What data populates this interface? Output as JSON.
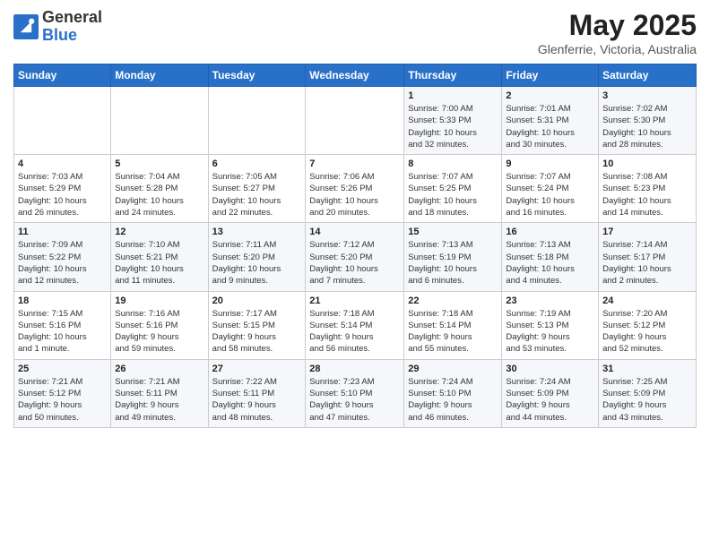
{
  "header": {
    "logo_general": "General",
    "logo_blue": "Blue",
    "month_year": "May 2025",
    "location": "Glenferrie, Victoria, Australia"
  },
  "weekdays": [
    "Sunday",
    "Monday",
    "Tuesday",
    "Wednesday",
    "Thursday",
    "Friday",
    "Saturday"
  ],
  "weeks": [
    [
      {
        "day": "",
        "info": ""
      },
      {
        "day": "",
        "info": ""
      },
      {
        "day": "",
        "info": ""
      },
      {
        "day": "",
        "info": ""
      },
      {
        "day": "1",
        "info": "Sunrise: 7:00 AM\nSunset: 5:33 PM\nDaylight: 10 hours\nand 32 minutes."
      },
      {
        "day": "2",
        "info": "Sunrise: 7:01 AM\nSunset: 5:31 PM\nDaylight: 10 hours\nand 30 minutes."
      },
      {
        "day": "3",
        "info": "Sunrise: 7:02 AM\nSunset: 5:30 PM\nDaylight: 10 hours\nand 28 minutes."
      }
    ],
    [
      {
        "day": "4",
        "info": "Sunrise: 7:03 AM\nSunset: 5:29 PM\nDaylight: 10 hours\nand 26 minutes."
      },
      {
        "day": "5",
        "info": "Sunrise: 7:04 AM\nSunset: 5:28 PM\nDaylight: 10 hours\nand 24 minutes."
      },
      {
        "day": "6",
        "info": "Sunrise: 7:05 AM\nSunset: 5:27 PM\nDaylight: 10 hours\nand 22 minutes."
      },
      {
        "day": "7",
        "info": "Sunrise: 7:06 AM\nSunset: 5:26 PM\nDaylight: 10 hours\nand 20 minutes."
      },
      {
        "day": "8",
        "info": "Sunrise: 7:07 AM\nSunset: 5:25 PM\nDaylight: 10 hours\nand 18 minutes."
      },
      {
        "day": "9",
        "info": "Sunrise: 7:07 AM\nSunset: 5:24 PM\nDaylight: 10 hours\nand 16 minutes."
      },
      {
        "day": "10",
        "info": "Sunrise: 7:08 AM\nSunset: 5:23 PM\nDaylight: 10 hours\nand 14 minutes."
      }
    ],
    [
      {
        "day": "11",
        "info": "Sunrise: 7:09 AM\nSunset: 5:22 PM\nDaylight: 10 hours\nand 12 minutes."
      },
      {
        "day": "12",
        "info": "Sunrise: 7:10 AM\nSunset: 5:21 PM\nDaylight: 10 hours\nand 11 minutes."
      },
      {
        "day": "13",
        "info": "Sunrise: 7:11 AM\nSunset: 5:20 PM\nDaylight: 10 hours\nand 9 minutes."
      },
      {
        "day": "14",
        "info": "Sunrise: 7:12 AM\nSunset: 5:20 PM\nDaylight: 10 hours\nand 7 minutes."
      },
      {
        "day": "15",
        "info": "Sunrise: 7:13 AM\nSunset: 5:19 PM\nDaylight: 10 hours\nand 6 minutes."
      },
      {
        "day": "16",
        "info": "Sunrise: 7:13 AM\nSunset: 5:18 PM\nDaylight: 10 hours\nand 4 minutes."
      },
      {
        "day": "17",
        "info": "Sunrise: 7:14 AM\nSunset: 5:17 PM\nDaylight: 10 hours\nand 2 minutes."
      }
    ],
    [
      {
        "day": "18",
        "info": "Sunrise: 7:15 AM\nSunset: 5:16 PM\nDaylight: 10 hours\nand 1 minute."
      },
      {
        "day": "19",
        "info": "Sunrise: 7:16 AM\nSunset: 5:16 PM\nDaylight: 9 hours\nand 59 minutes."
      },
      {
        "day": "20",
        "info": "Sunrise: 7:17 AM\nSunset: 5:15 PM\nDaylight: 9 hours\nand 58 minutes."
      },
      {
        "day": "21",
        "info": "Sunrise: 7:18 AM\nSunset: 5:14 PM\nDaylight: 9 hours\nand 56 minutes."
      },
      {
        "day": "22",
        "info": "Sunrise: 7:18 AM\nSunset: 5:14 PM\nDaylight: 9 hours\nand 55 minutes."
      },
      {
        "day": "23",
        "info": "Sunrise: 7:19 AM\nSunset: 5:13 PM\nDaylight: 9 hours\nand 53 minutes."
      },
      {
        "day": "24",
        "info": "Sunrise: 7:20 AM\nSunset: 5:12 PM\nDaylight: 9 hours\nand 52 minutes."
      }
    ],
    [
      {
        "day": "25",
        "info": "Sunrise: 7:21 AM\nSunset: 5:12 PM\nDaylight: 9 hours\nand 50 minutes."
      },
      {
        "day": "26",
        "info": "Sunrise: 7:21 AM\nSunset: 5:11 PM\nDaylight: 9 hours\nand 49 minutes."
      },
      {
        "day": "27",
        "info": "Sunrise: 7:22 AM\nSunset: 5:11 PM\nDaylight: 9 hours\nand 48 minutes."
      },
      {
        "day": "28",
        "info": "Sunrise: 7:23 AM\nSunset: 5:10 PM\nDaylight: 9 hours\nand 47 minutes."
      },
      {
        "day": "29",
        "info": "Sunrise: 7:24 AM\nSunset: 5:10 PM\nDaylight: 9 hours\nand 46 minutes."
      },
      {
        "day": "30",
        "info": "Sunrise: 7:24 AM\nSunset: 5:09 PM\nDaylight: 9 hours\nand 44 minutes."
      },
      {
        "day": "31",
        "info": "Sunrise: 7:25 AM\nSunset: 5:09 PM\nDaylight: 9 hours\nand 43 minutes."
      }
    ]
  ]
}
